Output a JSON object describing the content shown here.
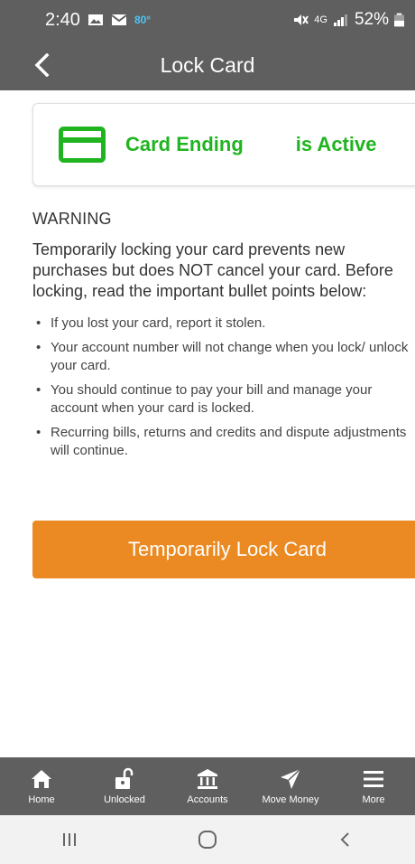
{
  "status_bar": {
    "time": "2:40",
    "temperature": "80°",
    "network": "4G",
    "battery": "52%"
  },
  "header": {
    "title": "Lock Card"
  },
  "card_status": {
    "prefix": "Card Ending",
    "suffix": "is Active",
    "color": "#20b420"
  },
  "warning": {
    "heading": "WARNING",
    "paragraph": "Temporarily locking your card prevents new purchases but does NOT cancel your card. Before locking, read the important bullet points below:",
    "bullets": [
      "If you lost your card, report it stolen.",
      "Your account number will not change when you lock/ unlock your card.",
      "You should continue to pay your bill and manage your account when your card is locked.",
      "Recurring bills, returns and credits and dispute adjustments will continue."
    ]
  },
  "lock_button": {
    "label": "Temporarily Lock Card",
    "color": "#eb8a23"
  },
  "bottom_nav": {
    "items": [
      {
        "label": "Home",
        "icon": "home-icon"
      },
      {
        "label": "Unlocked",
        "icon": "unlocked-icon"
      },
      {
        "label": "Accounts",
        "icon": "bank-icon"
      },
      {
        "label": "Move Money",
        "icon": "send-icon"
      },
      {
        "label": "More",
        "icon": "menu-icon"
      }
    ]
  },
  "system_nav": {
    "items": [
      "recents-icon",
      "home-circle-icon",
      "back-chevron-icon"
    ]
  }
}
